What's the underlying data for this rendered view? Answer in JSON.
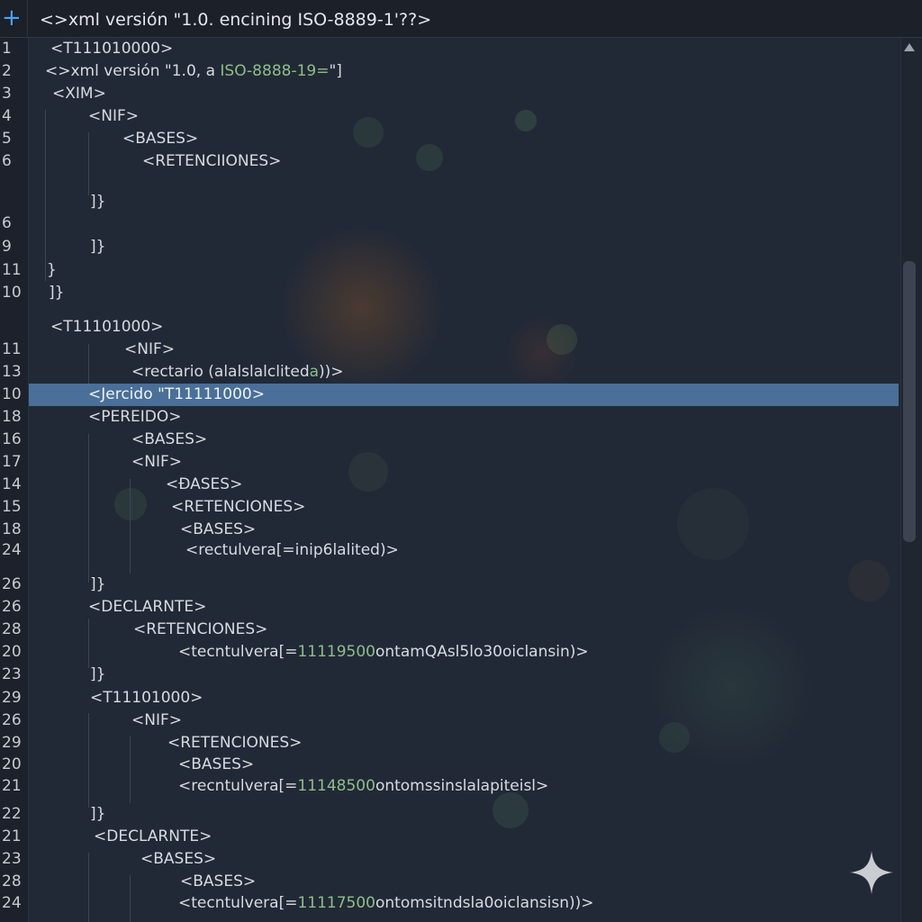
{
  "window": {
    "add_icon": "plus-icon",
    "tab_title": "<>xml versión \"1.0. encining ISO-8889-1'??>"
  },
  "editor": {
    "highlighted_line_number": "10",
    "lines": [
      {
        "num": "1",
        "text": "<T111010000>"
      },
      {
        "num": "2",
        "text": "<>xml versión \"1.0, a ",
        "text_green": "ISO-8888-19=",
        "text_after": "\"]"
      },
      {
        "num": "3",
        "text": "<XIM>"
      },
      {
        "num": "4",
        "text": "<NIF>"
      },
      {
        "num": "5",
        "text": "<BASES>"
      },
      {
        "num": "6",
        "text": "<RETENCIIONES>"
      },
      {
        "num": "",
        "text": "]}"
      },
      {
        "num": "6",
        "text": ""
      },
      {
        "num": "9",
        "text": "]}"
      },
      {
        "num": "11",
        "text": "}"
      },
      {
        "num": "10",
        "text": "]}"
      },
      {
        "num": "",
        "text": "<T11101000>"
      },
      {
        "num": "11",
        "text": "<NIF>"
      },
      {
        "num": "13",
        "text": "<rectario (alalslalclited",
        "text_green": "a",
        "text_after": "))>"
      },
      {
        "num": "10",
        "text": "<Jercido \"T11111000>"
      },
      {
        "num": "18",
        "text": "<PEREIDO>"
      },
      {
        "num": "16",
        "text": "<BASES>"
      },
      {
        "num": "17",
        "text": "<NIF>"
      },
      {
        "num": "14",
        "text": "<ĐASES>"
      },
      {
        "num": "15",
        "text": "<RETENCIONES>"
      },
      {
        "num": "18",
        "text": "<BASES>"
      },
      {
        "num": "24",
        "text": "<rectulvera[=inip6lalited)>"
      },
      {
        "num": "26",
        "text": "]}"
      },
      {
        "num": "26",
        "text": "<DECLARNTE>"
      },
      {
        "num": "28",
        "text": "<RETENCIONES>"
      },
      {
        "num": "20",
        "text": "<tecntulvera[=",
        "text_green": "11119500",
        "text_after": "ontamQAsl5lo30oiclansin)>"
      },
      {
        "num": "23",
        "text": "]}"
      },
      {
        "num": "29",
        "text": "<T11101000>"
      },
      {
        "num": "26",
        "text": "<NIF>"
      },
      {
        "num": "29",
        "text": "<RETENCIONES>"
      },
      {
        "num": "20",
        "text": "<BASES>"
      },
      {
        "num": "21",
        "text": "<recntulvera[=",
        "text_green": "11148500",
        "text_after": "ontomssinslalapiteisl>"
      },
      {
        "num": "22",
        "text": "]}"
      },
      {
        "num": "21",
        "text": "<DECLARNTE>"
      },
      {
        "num": "23",
        "text": "<BASES>"
      },
      {
        "num": "28",
        "text": "<BASES>"
      },
      {
        "num": "24",
        "text": "<tecntulvera[=",
        "text_green": "11117500",
        "text_after": "ontomsitndsla0oiclansisn))>"
      }
    ]
  },
  "scrollbar": {
    "up_arrow_icon": "triangle-up-icon"
  },
  "overlay": {
    "sparkle_icon": "sparkle-icon"
  }
}
